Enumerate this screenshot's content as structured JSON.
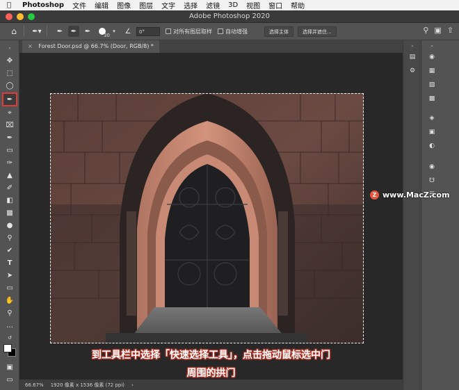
{
  "menubar": {
    "app_name": "Photoshop",
    "items": [
      "文件",
      "编辑",
      "图像",
      "图层",
      "文字",
      "选择",
      "滤镜",
      "3D",
      "视图",
      "窗口",
      "帮助"
    ]
  },
  "window": {
    "title": "Adobe Photoshop 2020"
  },
  "options": {
    "brush_size": "30",
    "angle_value": "0°",
    "sample_all_layers_label": "对所有图层取样",
    "auto_enhance_label": "自动增强",
    "select_subject_label": "选择主体",
    "select_and_mask_label": "选择并遮住..."
  },
  "document": {
    "tab_title": "Forest Door.psd @ 66.7% (Door, RGB/8) *",
    "zoom": "66.67%",
    "info": "1920 像素 x 1536 像素 (72 ppi)"
  },
  "caption": {
    "line1": "到工具栏中选择「快速选择工具」，点击拖动鼠标选中门",
    "line2": "周围的拱门"
  },
  "watermark": {
    "text": "www.MacZ.com"
  },
  "colors": {
    "highlight": "#e23a3a",
    "ui_dark": "#535353",
    "canvas_bg": "#282828"
  }
}
